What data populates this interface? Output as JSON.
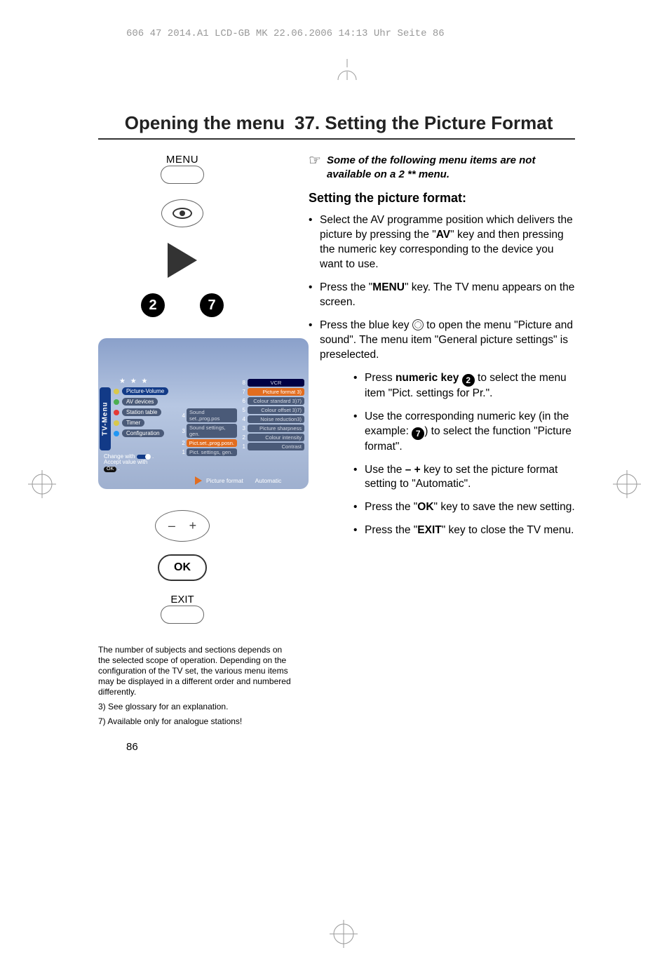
{
  "print_header": "606 47 2014.A1 LCD-GB MK  22.06.2006  14:13 Uhr  Seite 86",
  "titles": {
    "left": "Opening the menu",
    "right": "37. Setting the Picture Format"
  },
  "remote": {
    "menu_label": "MENU",
    "num_a": "2",
    "num_b": "7",
    "ok_label": "OK",
    "exit_label": "EXIT",
    "plus": "+",
    "minus": "–"
  },
  "osd": {
    "side_tab": "TV-Menu",
    "stars": "★ ★ ★",
    "left_menu": [
      {
        "dot": "y",
        "label": "Picture-Volume",
        "selected": true
      },
      {
        "dot": "g",
        "label": "AV devices"
      },
      {
        "dot": "r",
        "label": "Station table"
      },
      {
        "dot": "y",
        "label": "Timer"
      },
      {
        "dot": "b",
        "label": "Configuration"
      }
    ],
    "mid_menu": [
      {
        "n": "4",
        "label": "Sound set.,prog.pos"
      },
      {
        "n": "3",
        "label": "Sound settings, gen."
      },
      {
        "n": "2",
        "label": "Pict.set.,prog.posn.",
        "selected": true
      },
      {
        "n": "1",
        "label": "Pict. settings, gen."
      }
    ],
    "right_menu": [
      {
        "n": "8",
        "label": "VCR",
        "vcr": true
      },
      {
        "n": "7",
        "label": "Picture format 3)",
        "selected": true
      },
      {
        "n": "6",
        "label": "Colour standard 3)7)"
      },
      {
        "n": "5",
        "label": "Colour offset 3)7)"
      },
      {
        "n": "4",
        "label": "Noise reduction3)"
      },
      {
        "n": "3",
        "label": "Picture sharpness"
      },
      {
        "n": "2",
        "label": "Colour intensity"
      },
      {
        "n": "1",
        "label": "Contrast"
      }
    ],
    "help_line1": "Change with",
    "help_line2": "Accept value with",
    "help_ok": "OK",
    "status_label": "Picture format",
    "status_value": "Automatic"
  },
  "footnotes": {
    "p1": "The number of subjects and sections depends on the selected scope of operation. Depending on the configuration of the TV set, the various menu items may be displayed in a different order and numbered differently.",
    "p2": "3) See glossary for an explanation.",
    "p3": "7) Available only for analogue stations!"
  },
  "page_number": "86",
  "right_col": {
    "note": "Some of the following menu items are not available on a 2 ** menu.",
    "subhead": "Setting the picture format:",
    "s1a": "Select the AV programme position which delivers the picture by pressing the \"",
    "s1b": "AV",
    "s1c": "\" key and then pressing the numeric key corresponding to the device you want to use.",
    "s2a": "Press the \"",
    "s2b": "MENU",
    "s2c": "\" key. The TV menu appears on the screen.",
    "s3a": "Press the blue key ",
    "s3b": " to open the menu \"Picture and sound\". The menu item \"General picture settings\" is preselected.",
    "s4a": "Press ",
    "s4b": "numeric key",
    "s4c": " ",
    "s4d": " to select the menu item \"Pict. settings for Pr.\".",
    "s4_badge": "2",
    "s5a": "Use the corresponding numeric key (in the example: ",
    "s5_badge": "7",
    "s5b": ") to select the function \"Picture format\".",
    "s6a": "Use the ",
    "s6minus": "–",
    "s6plus": "+",
    "s6b": " key to set the picture format setting to \"Automatic\".",
    "s7a": "Press the \"",
    "s7b": "OK",
    "s7c": "\" key to save the new setting.",
    "s8a": "Press the \"",
    "s8b": "EXIT",
    "s8c": "\" key to close the TV menu."
  }
}
